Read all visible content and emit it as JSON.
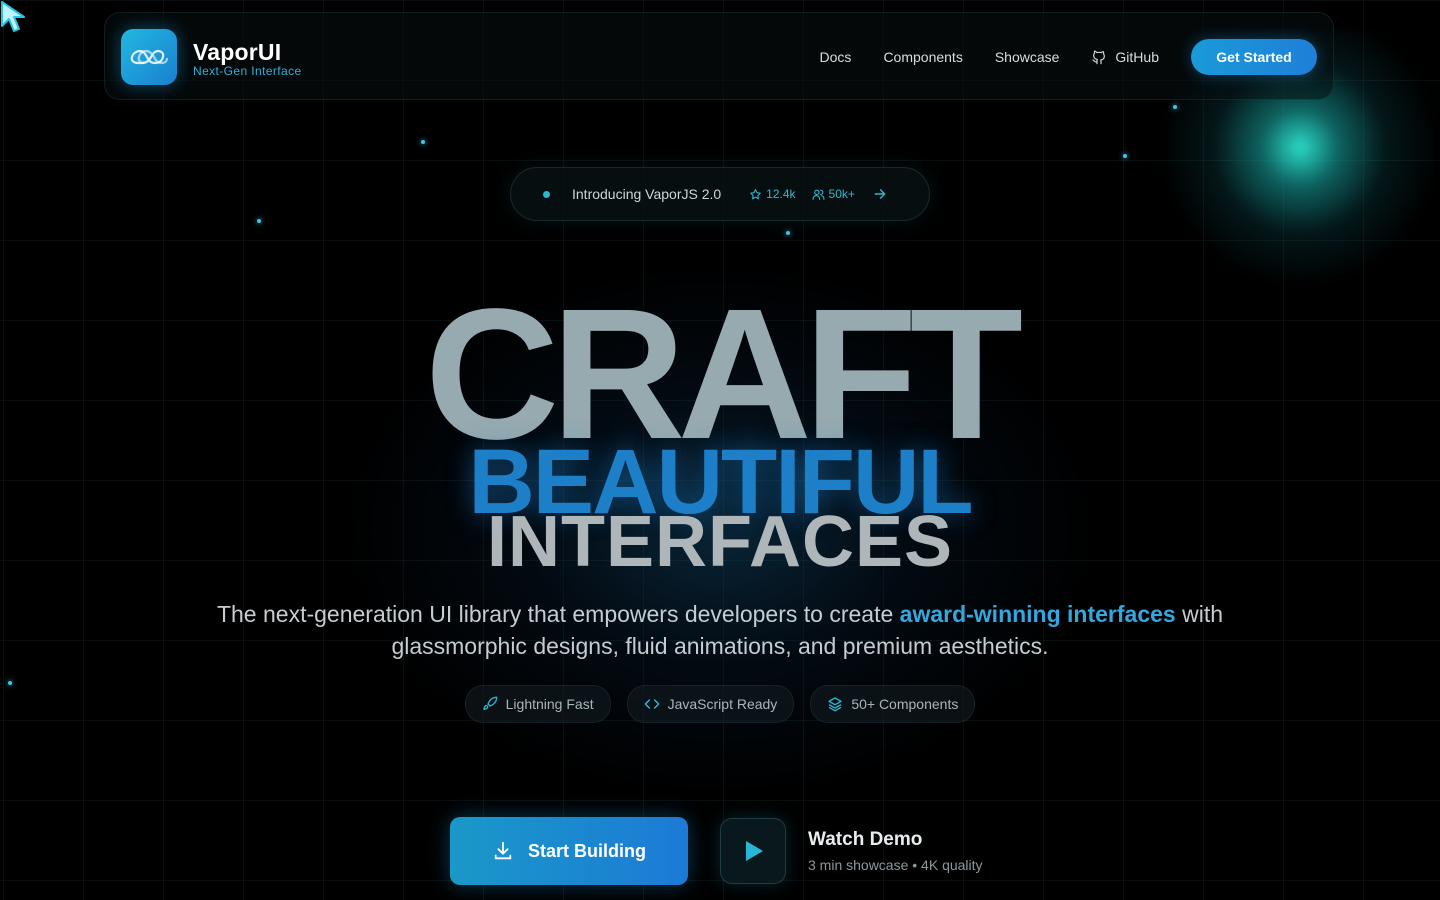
{
  "brand": {
    "name": "VaporUI",
    "tagline": "Next-Gen Interface"
  },
  "nav": {
    "links": [
      "Docs",
      "Components",
      "Showcase",
      "GitHub"
    ],
    "cta_label": "Get Started"
  },
  "announcement": {
    "text": "Introducing VaporJS 2.0",
    "stars": "12.4k",
    "users": "50k+"
  },
  "hero": {
    "line1": "CRAFT",
    "line2": "BEAUTIFUL",
    "line3": "INTERFACES",
    "subtitle_before": "The next-generation UI library that empowers developers to create ",
    "subtitle_highlight": "award-winning interfaces",
    "subtitle_after": " with glassmorphic designs, fluid animations, and premium aesthetics."
  },
  "features": [
    "Lightning Fast",
    "JavaScript Ready",
    "50+ Components"
  ],
  "actions": {
    "primary_label": "Start Building",
    "demo_title": "Watch Demo",
    "demo_subtitle": "3 min showcase • 4K quality"
  },
  "colors": {
    "accent": "#1e7fd8",
    "teal": "#2fb6c8",
    "background": "#000000"
  }
}
